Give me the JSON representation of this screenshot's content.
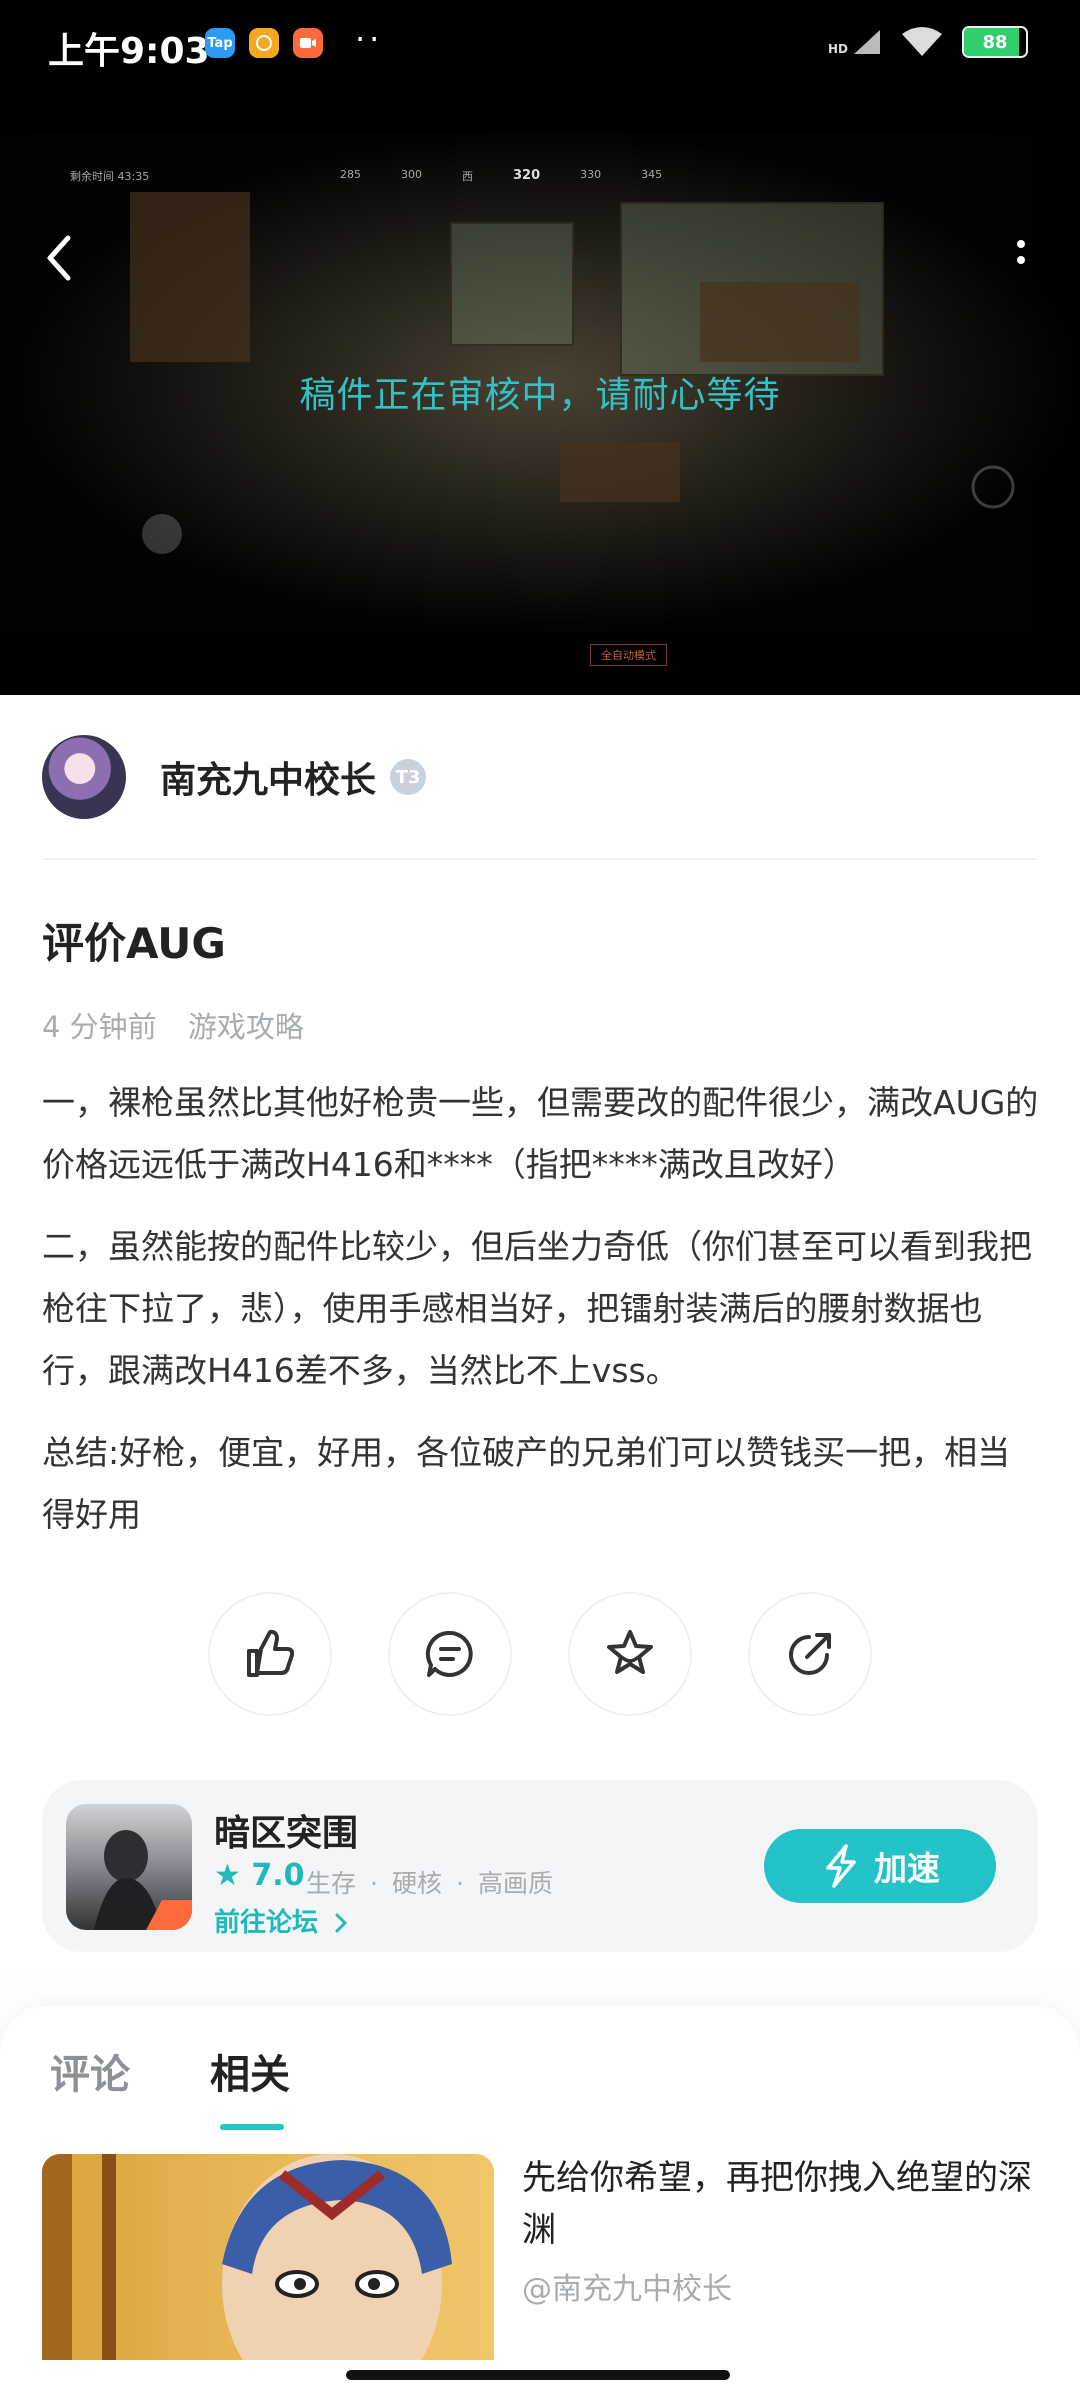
{
  "status_bar": {
    "time": "上午9:03",
    "apps": [
      {
        "name": "taptap-icon",
        "label": "Tap",
        "color": "#2a9bf5"
      },
      {
        "name": "browser-icon",
        "label": "",
        "color": "#f5a623"
      },
      {
        "name": "video-icon",
        "label": "",
        "color": "#ff6a3d"
      }
    ],
    "more": "··",
    "hd_label": "HD",
    "battery_level": "88",
    "battery_fraction": 0.88
  },
  "video": {
    "review_message": "稿件正在审核中，请耐心等待",
    "hud": {
      "timer": "剩余时间 43:35",
      "compass_values": [
        "285",
        "300",
        "西",
        "320",
        "330",
        "345"
      ],
      "button_label": "全自动模式"
    }
  },
  "author": {
    "name": "南充九中校长",
    "level": "T3"
  },
  "post": {
    "title": "评价AUG",
    "time_ago": "4 分钟前",
    "category": "游戏攻略",
    "paragraphs": [
      "一，裸枪虽然比其他好枪贵一些，但需要改的配件很少，满改AUG的价格远远低于满改H416和****（指把****满改且改好）",
      "二，虽然能按的配件比较少，但后坐力奇低（你们甚至可以看到我把枪往下拉了，悲），使用手感相当好，把镭射装满后的腰射数据也行，跟满改H416差不多，当然比不上vss。",
      "总结:好枪，便宜，好用，各位破产的兄弟们可以赞钱买一把，相当得好用"
    ]
  },
  "game": {
    "name": "暗区突围",
    "rating": "7.0",
    "tags": [
      "生存",
      "硬核",
      "高画质"
    ],
    "tag_separator": "·",
    "forum_link": "前往论坛",
    "speed_button": "加速",
    "accent": "#23c3c7"
  },
  "tabs": {
    "comments": "评论",
    "related": "相关"
  },
  "related": {
    "title": "先给你希望，再把你拽入绝望的深渊",
    "author": "@南充九中校长"
  }
}
